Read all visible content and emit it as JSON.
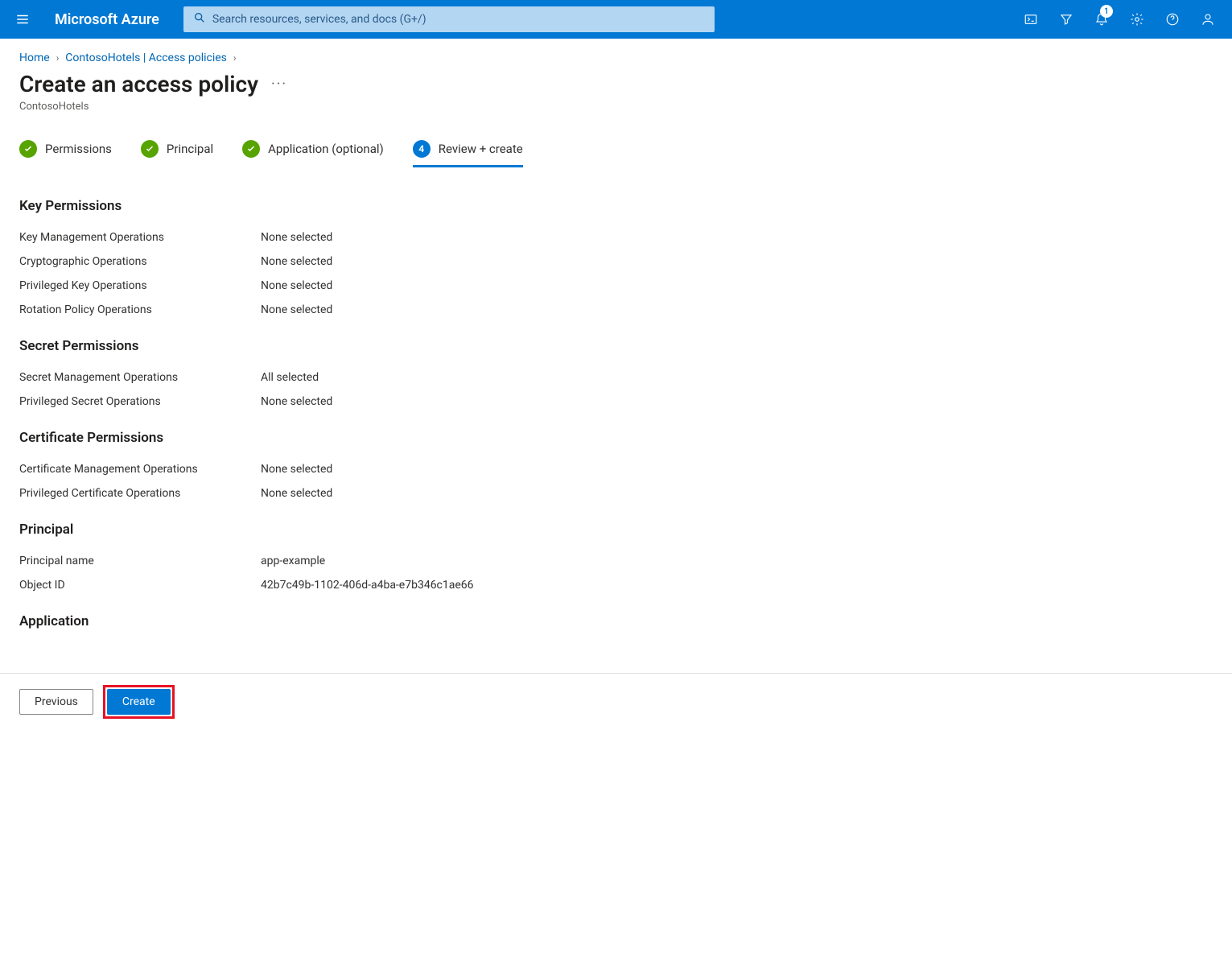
{
  "header": {
    "brand": "Microsoft Azure",
    "search_placeholder": "Search resources, services, and docs (G+/)",
    "notification_count": "1"
  },
  "breadcrumb": {
    "items": [
      {
        "label": "Home"
      },
      {
        "label": "ContosoHotels | Access policies"
      }
    ]
  },
  "page": {
    "title": "Create an access policy",
    "subtitle": "ContosoHotels"
  },
  "steps": [
    {
      "label": "Permissions",
      "state": "done"
    },
    {
      "label": "Principal",
      "state": "done"
    },
    {
      "label": "Application (optional)",
      "state": "done"
    },
    {
      "label": "Review + create",
      "state": "active",
      "num": "4"
    }
  ],
  "sections": {
    "key_permissions": {
      "title": "Key Permissions",
      "rows": [
        {
          "k": "Key Management Operations",
          "v": "None selected"
        },
        {
          "k": "Cryptographic Operations",
          "v": "None selected"
        },
        {
          "k": "Privileged Key Operations",
          "v": "None selected"
        },
        {
          "k": "Rotation Policy Operations",
          "v": "None selected"
        }
      ]
    },
    "secret_permissions": {
      "title": "Secret Permissions",
      "rows": [
        {
          "k": "Secret Management Operations",
          "v": "All selected"
        },
        {
          "k": "Privileged Secret Operations",
          "v": "None selected"
        }
      ]
    },
    "certificate_permissions": {
      "title": "Certificate Permissions",
      "rows": [
        {
          "k": "Certificate Management Operations",
          "v": "None selected"
        },
        {
          "k": "Privileged Certificate Operations",
          "v": "None selected"
        }
      ]
    },
    "principal": {
      "title": "Principal",
      "rows": [
        {
          "k": "Principal name",
          "v": "app-example"
        },
        {
          "k": "Object ID",
          "v": "42b7c49b-1102-406d-a4ba-e7b346c1ae66"
        }
      ]
    },
    "application": {
      "title": "Application",
      "rows": []
    }
  },
  "footer": {
    "previous": "Previous",
    "create": "Create"
  }
}
